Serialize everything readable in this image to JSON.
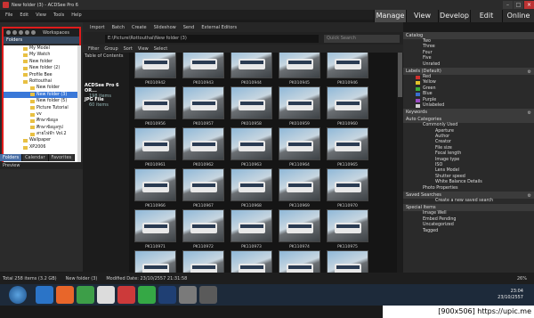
{
  "window": {
    "title": "New folder (3) - ACDSee Pro 6"
  },
  "menu": [
    "File",
    "Edit",
    "View",
    "Tools",
    "Help"
  ],
  "modes": [
    "Manage",
    "View",
    "Develop",
    "Edit",
    "Online"
  ],
  "workspaces_label": "Workspaces",
  "folders_label": "Folders",
  "tree": [
    "My Model",
    "My Watch",
    "New folder",
    "New folder (2)",
    "Profile Bee",
    "Rottouthai",
    "New folder",
    "New folder (3)",
    "New folder (5)",
    "Picture Tutorial",
    "vv",
    "ศึกษาข้อมูล",
    "ศึกษาข้อมูลรูป",
    "สายไฟฟ้า Vol.2",
    "Wallpaper",
    "XP2006"
  ],
  "left_tabs": [
    "Folders",
    "Calendar",
    "Favorites"
  ],
  "preview_label": "Preview",
  "toolbar": [
    "Import",
    "Batch",
    "Create",
    "Slideshow",
    "Send",
    "External Editors"
  ],
  "path": "E:\\Picture\\Rottouthai\\New folder (3)",
  "quick_search": "Quick Search",
  "filters": [
    "Filter",
    "Group",
    "Sort",
    "View",
    "Select"
  ],
  "toc_label": "Table of Contents",
  "toc_groups": [
    {
      "title": "ACDSee Pro 6 OR...",
      "count": "198 items"
    },
    {
      "title": "JPG File",
      "count": "60 items"
    }
  ],
  "rows": [
    [
      "PK010942",
      "PK010943",
      "PK010944",
      "PK010945",
      "PK010946"
    ],
    [
      "PK010956",
      "PK010957",
      "PK010958",
      "PK010959",
      "PK010960"
    ],
    [
      "PK010961",
      "PK010962",
      "PK110963",
      "PK110964",
      "PK110965"
    ],
    [
      "PK110966",
      "PK110967",
      "PK110968",
      "PK110969",
      "PK110970"
    ],
    [
      "PK110971",
      "PK110972",
      "PK110973",
      "PK110974",
      "PK110975"
    ],
    [
      "PK110976",
      "PK110977",
      "PK110978",
      "PK110979",
      "PK110980"
    ]
  ],
  "catalog_label": "Catalog",
  "ratings": [
    "Two",
    "Three",
    "Four",
    "Five",
    "Unrated"
  ],
  "labels_header": "Labels (Default)",
  "labels": [
    {
      "name": "Red",
      "color": "#d0312d"
    },
    {
      "name": "Yellow",
      "color": "#e2c22a"
    },
    {
      "name": "Green",
      "color": "#3cae3c"
    },
    {
      "name": "Blue",
      "color": "#3a6fd0"
    },
    {
      "name": "Purple",
      "color": "#9b4bc4"
    },
    {
      "name": "Unlabeled",
      "color": "#cfcfcf"
    }
  ],
  "keywords_header": "Keywords",
  "auto_header": "Auto Categories",
  "auto_items": [
    "Commonly Used",
    "Aperture",
    "Author",
    "Creator",
    "File size",
    "Focal length",
    "Image type",
    "ISO",
    "Lens Model",
    "Shutter speed",
    "White Balance Details",
    "Photo Properties"
  ],
  "saved_header": "Saved Searches",
  "saved_item": "Create a new saved search",
  "special_header": "Special Items",
  "special_items": [
    "Image Well",
    "Embed Pending",
    "Uncategorized",
    "Tagged"
  ],
  "status": {
    "total": "Total 258 items (3.2 GB)",
    "folder": "New folder (3)",
    "modified": "Modified Date: 23/10/2557 21:31:58",
    "zoom": "26%"
  },
  "clock": {
    "time": "23:04",
    "date": "23/10/2557"
  },
  "watermark": "[900x506] https://upic.me"
}
